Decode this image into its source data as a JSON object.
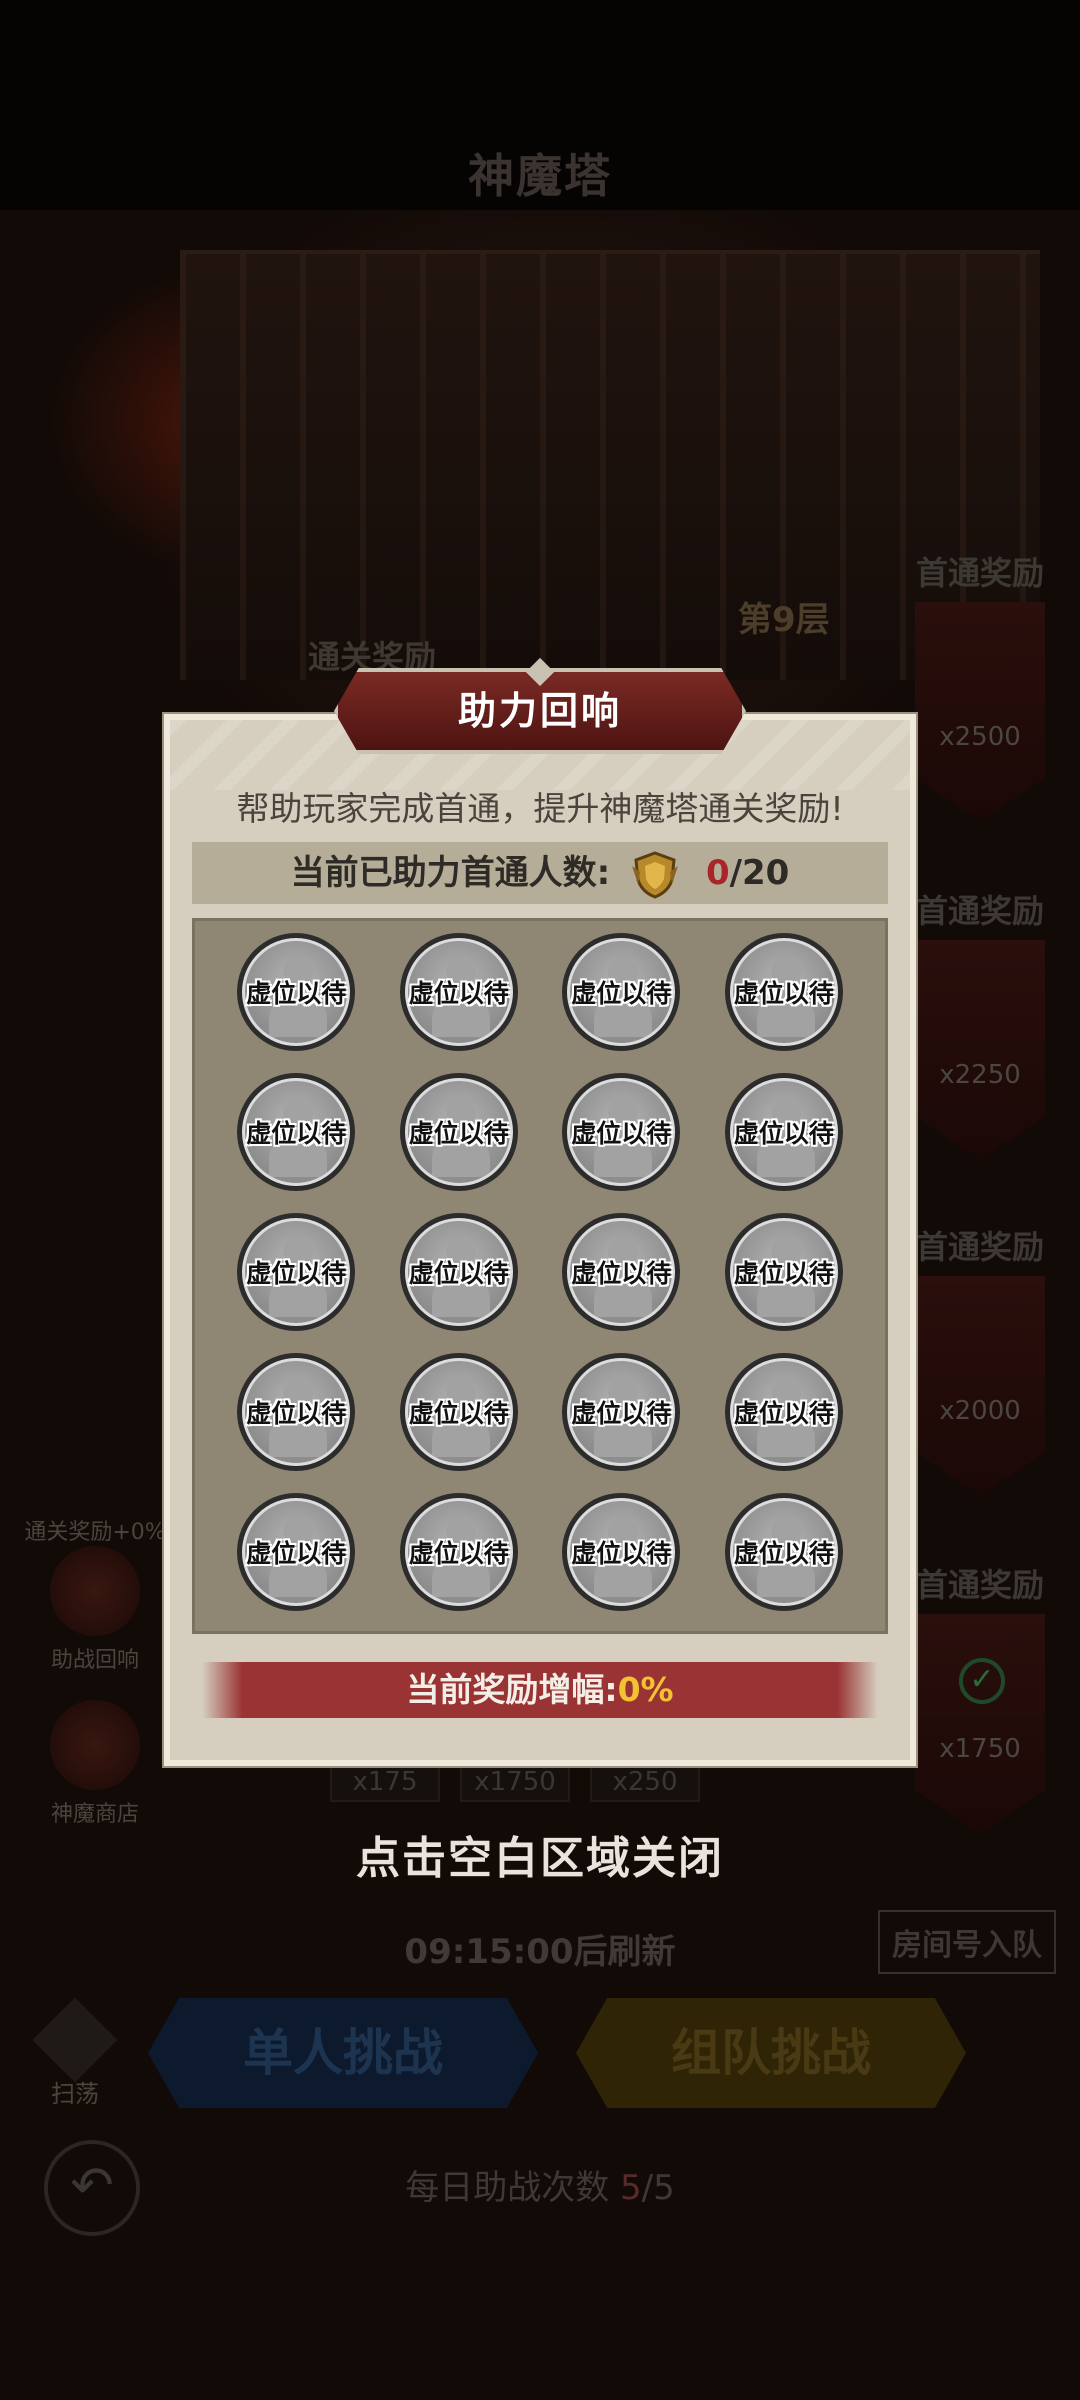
{
  "background": {
    "tower_title": "神魔塔",
    "floor_label": "第9层",
    "clear_reward_label": "通关奖励",
    "first_clear_rewards": [
      {
        "title": "首通奖励",
        "amount": "x2500"
      },
      {
        "title": "首通奖励",
        "amount": "x2250"
      },
      {
        "title": "首通奖励",
        "amount": "x2000"
      },
      {
        "title": "首通奖励",
        "amount": "x1750"
      }
    ],
    "side_buttons": {
      "assist_echo_bonus": "通关奖励+0%",
      "assist_echo": "助战回响",
      "shop": "神魔商店"
    },
    "bottom_rewards": [
      "x175",
      "x1750",
      "x250"
    ],
    "refresh_timer": "09:15:00后刷新",
    "room_join": "房间号入队",
    "sweep": "扫荡",
    "single_challenge": "单人挑战",
    "team_challenge": "组队挑战",
    "daily_assist_label": "每日助战次数",
    "daily_assist_used": "5",
    "daily_assist_total": "/5"
  },
  "popup": {
    "title": "助力回响",
    "description": "帮助玩家完成首通，提升神魔塔通关奖励!",
    "assist_count_label": "当前已助力首通人数:",
    "assist_count_current": "0",
    "assist_count_total": "/20",
    "slot_label": "虚位以待",
    "slot_count": 20,
    "boost_label": "当前奖励增幅:",
    "boost_value": "0%"
  },
  "close_hint": "点击空白区域关闭",
  "colors": {
    "popup_bg": "#d6cfc0",
    "title_banner": "#7a2a24",
    "boost_bar": "#9a3434",
    "highlight_red": "#a8262a",
    "highlight_gold": "#f2c233"
  }
}
